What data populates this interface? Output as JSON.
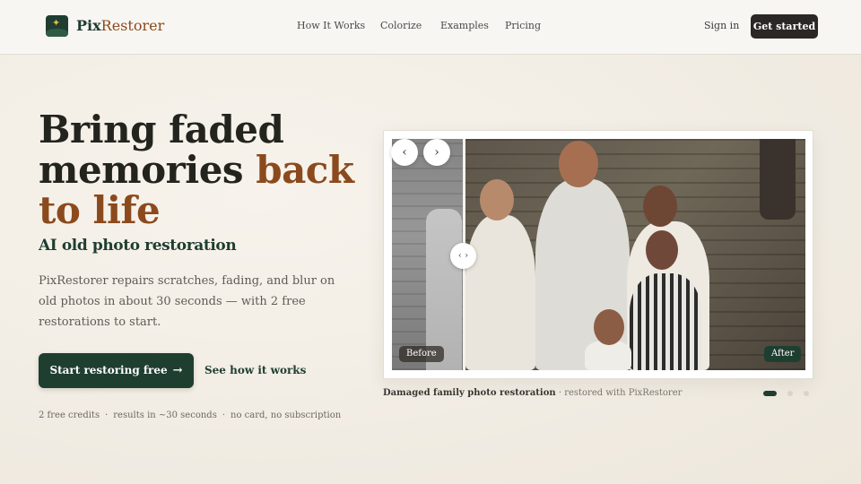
{
  "header": {
    "brand_part1": "Pix",
    "brand_part2": "Restorer",
    "nav": [
      "How It Works",
      "Colorize",
      "Examples",
      "Pricing"
    ],
    "sign_in": "Sign in",
    "get_started": "Get started"
  },
  "hero": {
    "title_line1": "Bring faded",
    "title_line2_plain": "memories ",
    "title_line2_accent": "back",
    "title_line3_accent": "to life",
    "subheading": "AI old photo restoration",
    "description": "PixRestorer repairs scratches, fading, and blur on old photos in about 30 seconds — with 2 free restorations to start.",
    "cta_label": "Start restoring free",
    "secondary_link": "See how it works",
    "meta": [
      "2 free credits",
      "results in ~30 seconds",
      "no card, no subscription"
    ],
    "meta_separator": "·"
  },
  "compare": {
    "before_label": "Before",
    "after_label": "After",
    "prev_icon": "‹",
    "next_icon": "›",
    "handle_icon": "‹ ›",
    "caption_bold": "Damaged family photo restoration",
    "caption_rest": " · restored with PixRestorer",
    "slides_total": 3,
    "active_slide": 1
  },
  "colors": {
    "brand_green": "#1e3e30",
    "accent_brown": "#8b4a1d",
    "dark_button": "#2b2725"
  }
}
